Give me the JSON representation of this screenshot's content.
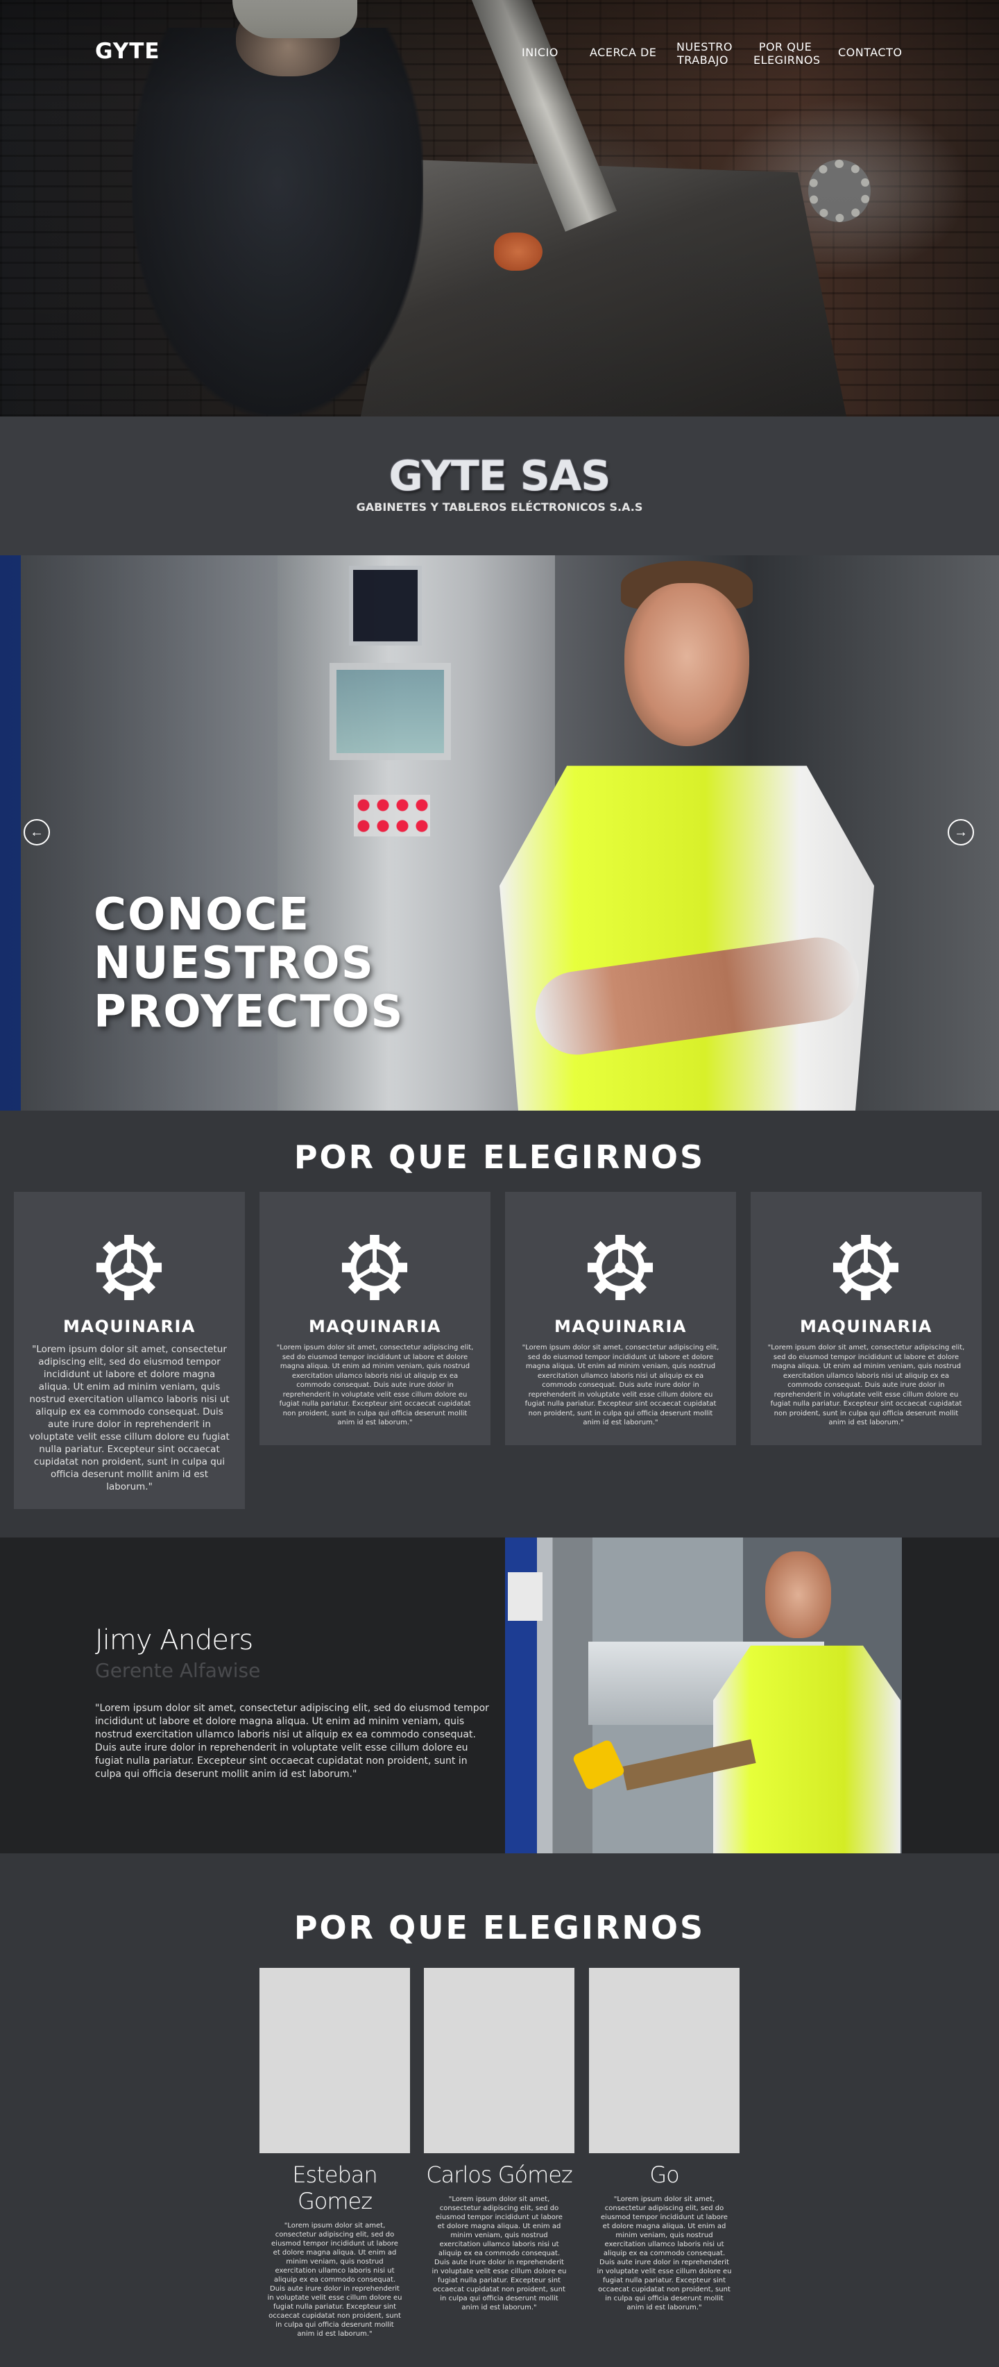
{
  "nav": {
    "logo": "GYTE",
    "items": [
      {
        "label": "INICIO"
      },
      {
        "label": "ACERCA DE"
      },
      {
        "label": "NUESTRO TRABAJO"
      },
      {
        "label": "POR QUE ELEGIRNOS"
      },
      {
        "label": "CONTACTO"
      }
    ]
  },
  "brand": {
    "title": "GYTE SAS",
    "subtitle": "GABINETES Y TABLEROS ELÉCTRONICOS S.A.S"
  },
  "slider": {
    "title": "CONOCE NUESTROS PROYECTOS",
    "prev_icon": "arrow-left-icon",
    "next_icon": "arrow-right-icon"
  },
  "features": {
    "title": "POR QUE ELEGIRNOS",
    "icon": "gear-icon",
    "cards": [
      {
        "title": "MAQUINARIA",
        "text": "\"Lorem ipsum dolor sit amet, consectetur adipiscing elit, sed do eiusmod tempor incididunt ut labore et dolore magna aliqua. Ut enim ad minim veniam, quis nostrud exercitation ullamco laboris nisi ut aliquip ex ea commodo consequat. Duis aute irure dolor in reprehenderit in voluptate velit esse cillum dolore eu fugiat nulla pariatur. Excepteur sint occaecat cupidatat non proident, sunt in culpa qui officia deserunt mollit anim id est laborum.\""
      },
      {
        "title": "MAQUINARIA",
        "text": "\"Lorem ipsum dolor sit amet, consectetur adipiscing elit, sed do eiusmod tempor incididunt ut labore et dolore magna aliqua. Ut enim ad minim veniam, quis nostrud exercitation ullamco laboris nisi ut aliquip ex ea commodo consequat. Duis aute irure dolor in reprehenderit in voluptate velit esse cillum dolore eu fugiat nulla pariatur. Excepteur sint occaecat cupidatat non proident, sunt in culpa qui officia deserunt mollit anim id est laborum.\""
      },
      {
        "title": "MAQUINARIA",
        "text": "\"Lorem ipsum dolor sit amet, consectetur adipiscing elit, sed do eiusmod tempor incididunt ut labore et dolore magna aliqua. Ut enim ad minim veniam, quis nostrud exercitation ullamco laboris nisi ut aliquip ex ea commodo consequat. Duis aute irure dolor in reprehenderit in voluptate velit esse cillum dolore eu fugiat nulla pariatur. Excepteur sint occaecat cupidatat non proident, sunt in culpa qui officia deserunt mollit anim id est laborum.\""
      },
      {
        "title": "MAQUINARIA",
        "text": "\"Lorem ipsum dolor sit amet, consectetur adipiscing elit, sed do eiusmod tempor incididunt ut labore et dolore magna aliqua. Ut enim ad minim veniam, quis nostrud exercitation ullamco laboris nisi ut aliquip ex ea commodo consequat. Duis aute irure dolor in reprehenderit in voluptate velit esse cillum dolore eu fugiat nulla pariatur. Excepteur sint occaecat cupidatat non proident, sunt in culpa qui officia deserunt mollit anim id est laborum.\""
      }
    ]
  },
  "testimonial": {
    "name": "Jimy Anders",
    "role": "Gerente Alfawise",
    "text": "\"Lorem ipsum dolor sit amet, consectetur adipiscing elit, sed do eiusmod tempor incididunt ut labore et dolore magna aliqua. Ut enim ad minim veniam, quis nostrud exercitation ullamco laboris nisi ut aliquip ex ea commodo consequat. Duis aute irure dolor in reprehenderit in voluptate velit esse cillum dolore eu fugiat nulla pariatur. Excepteur sint occaecat cupidatat non proident, sunt in culpa qui officia deserunt mollit anim id est laborum.\""
  },
  "team": {
    "title": "POR QUE ELEGIRNOS",
    "members": [
      {
        "name": "Esteban Gomez",
        "text": "\"Lorem ipsum dolor sit amet, consectetur adipiscing elit, sed do eiusmod tempor incididunt ut labore et dolore magna aliqua. Ut enim ad minim veniam, quis nostrud exercitation ullamco laboris nisi ut aliquip ex ea commodo consequat. Duis aute irure dolor in reprehenderit in voluptate velit esse cillum dolore eu fugiat nulla pariatur. Excepteur sint occaecat cupidatat non proident, sunt in culpa qui officia deserunt mollit anim id est laborum.\""
      },
      {
        "name": "Carlos Gómez",
        "text": "\"Lorem ipsum dolor sit amet, consectetur adipiscing elit, sed do eiusmod tempor incididunt ut labore et dolore magna aliqua. Ut enim ad minim veniam, quis nostrud exercitation ullamco laboris nisi ut aliquip ex ea commodo consequat. Duis aute irure dolor in reprehenderit in voluptate velit esse cillum dolore eu fugiat nulla pariatur. Excepteur sint occaecat cupidatat non proident, sunt in culpa qui officia deserunt mollit anim id est laborum.\""
      },
      {
        "name": "Go",
        "text": "\"Lorem ipsum dolor sit amet, consectetur adipiscing elit, sed do eiusmod tempor incididunt ut labore et dolore magna aliqua. Ut enim ad minim veniam, quis nostrud exercitation ullamco laboris nisi ut aliquip ex ea commodo consequat. Duis aute irure dolor in reprehenderit in voluptate velit esse cillum dolore eu fugiat nulla pariatur. Excepteur sint occaecat cupidatat non proident, sunt in culpa qui officia deserunt mollit anim id est laborum.\""
      }
    ]
  }
}
